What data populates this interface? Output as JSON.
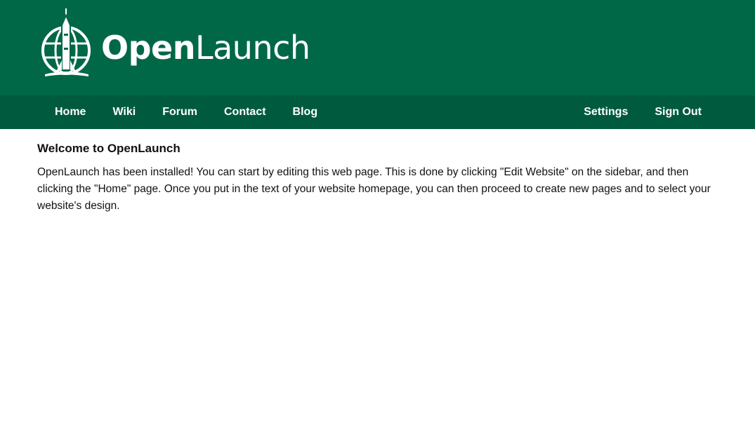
{
  "brand": {
    "name_bold": "Open",
    "name_regular": "Launch",
    "logo_icon": "globe-rocket-icon"
  },
  "colors": {
    "header_bg": "#006847",
    "nav_bg": "#005b3e",
    "nav_text": "#ffffff",
    "body_text": "#111111"
  },
  "nav": {
    "left": [
      {
        "label": "Home"
      },
      {
        "label": "Wiki"
      },
      {
        "label": "Forum"
      },
      {
        "label": "Contact"
      },
      {
        "label": "Blog"
      }
    ],
    "right": [
      {
        "label": "Settings"
      },
      {
        "label": "Sign Out"
      }
    ]
  },
  "main": {
    "title": "Welcome to OpenLaunch",
    "body": "OpenLaunch has been installed! You can start by editing this web page. This is done by clicking \"Edit Website\" on the sidebar, and then clicking the \"Home\" page. Once you put in the text of your website homepage, you can then proceed to create new pages and to select your website's design."
  }
}
